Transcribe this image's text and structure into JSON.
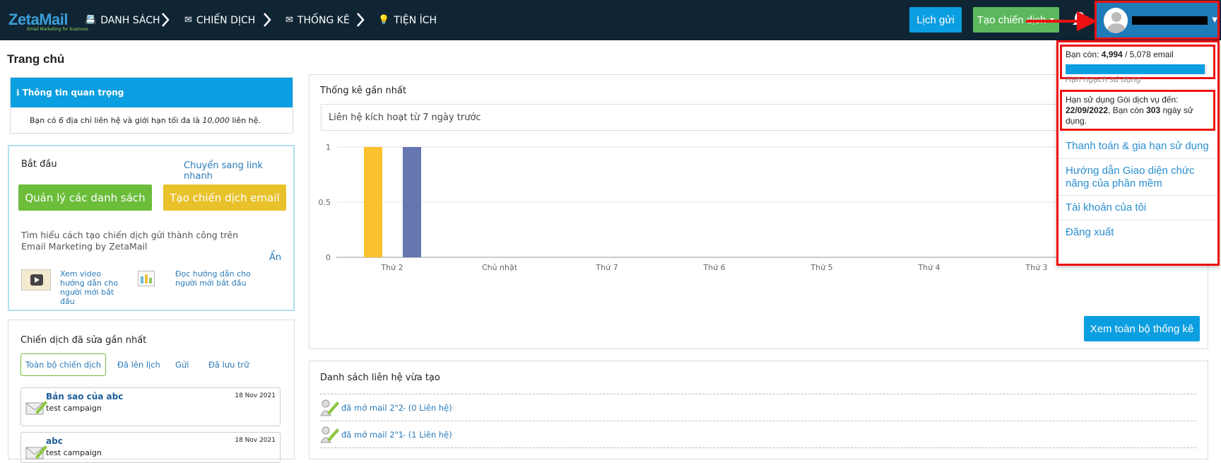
{
  "topbar": {
    "logo_text": "ZetaMail",
    "logo_sub": "Email Marketing for business",
    "nav": [
      {
        "label": "DANH SÁCH",
        "icon": "list-icon"
      },
      {
        "label": "CHIẾN DỊCH",
        "icon": "mail-icon"
      },
      {
        "label": "THỐNG KÊ",
        "icon": "mail-icon"
      },
      {
        "label": "TIỆN ÍCH",
        "icon": "bulb-icon"
      }
    ],
    "lich_gui": "Lịch gửi",
    "tao_chien_dich": "Tạo chiến dịch"
  },
  "page": {
    "title": "Trang chủ"
  },
  "info": {
    "header": "Thông tin quan trọng",
    "body_pre": "Bạn có ",
    "body_count": "6",
    "body_mid": " địa chỉ liên hệ và giới hạn tối đa là ",
    "body_limit": "10,000",
    "body_post": " liên hệ."
  },
  "start": {
    "title": "Bắt đầu",
    "switch_link": "Chuyển sang link nhanh",
    "manage_btn": "Quản lý các danh sách",
    "create_btn": "Tạo chiến dịch email",
    "learn_text": "Tìm hiểu cách tạo chiến dịch gửi thành công trên Email Marketing by ZetaMail",
    "hide": "Ẩn",
    "video_link": "Xem video hướng dẫn cho người mới bắt đầu",
    "doc_link": "Đọc hướng dẫn cho người mới bắt đầu"
  },
  "recent": {
    "title": "Chiến dịch đã sửa gần nhất",
    "tabs": [
      "Toàn bộ chiến dịch",
      "Đã lên lịch",
      "Gửi",
      "Đã lưu trữ"
    ],
    "items": [
      {
        "name": "Bản sao của abc",
        "sub": "test campaign",
        "date": "18 Nov 2021"
      },
      {
        "name": "abc",
        "sub": "test campaign",
        "date": "18 Nov 2021"
      }
    ]
  },
  "stats": {
    "title": "Thống kê gần nhất",
    "select": "Liên hệ kích hoạt từ 7 ngày trước",
    "view_all": "Xem toàn bộ thống kê"
  },
  "chart_data": {
    "type": "bar",
    "categories": [
      "Thứ 2",
      "Chủ nhật",
      "Thứ 7",
      "Thứ 6",
      "Thứ 5",
      "Thứ 4",
      "Thứ 3"
    ],
    "series": [
      {
        "values": [
          1,
          0,
          0,
          0,
          0,
          0,
          0
        ],
        "color": "#fbc02d"
      },
      {
        "values": [
          1,
          0,
          0,
          0,
          0,
          0,
          0
        ],
        "color": "#6576b0"
      }
    ],
    "yticks": [
      "0",
      "0.5",
      "1"
    ],
    "ylim": [
      0,
      1
    ],
    "grid": true
  },
  "contacts": {
    "title": "Danh sách liên hệ vừa tạo",
    "items": [
      {
        "name": "đã mở mail 2\"2",
        "count": " - (0 Liên hệ)"
      },
      {
        "name": "đã mở mail 2\"1",
        "count": " - (1 Liên hệ)"
      }
    ]
  },
  "dropdown": {
    "quota_label": "Bạn còn: ",
    "quota_remaining": "4,994",
    "quota_total": " / 5,078 email",
    "quota_fraction": 0.983,
    "quota_caption": "Hạn ngạch sử dụng",
    "expiry_line1": "Hạn sử dụng Gói dịch vụ đến:",
    "expiry_date": "22/09/2022",
    "expiry_mid": ", Bạn còn ",
    "expiry_days": "303",
    "expiry_post": " ngày sử dụng.",
    "menu": [
      "Thanh toán & gia hạn sử dụng",
      "Hướng dẫn Giao diện chức năng của phần mềm",
      "Tài khoản của tôi",
      "Đăng xuất"
    ]
  },
  "colors": {
    "accent": "#0b9ee0",
    "topbar": "#102534",
    "green": "#6cbd3a",
    "yellow": "#e9c12a",
    "highlight": "#e11111"
  }
}
